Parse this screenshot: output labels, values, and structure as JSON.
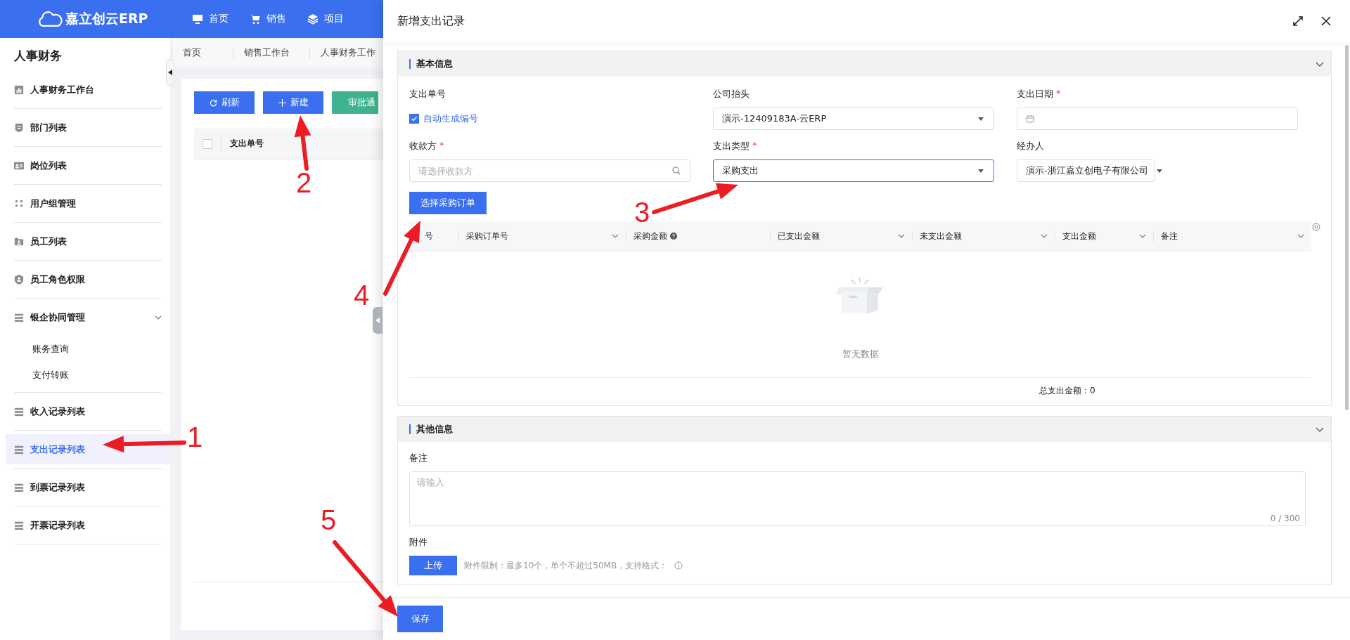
{
  "topbar": {
    "logo": "嘉立创云ERP",
    "nav": [
      {
        "label": "首页"
      },
      {
        "label": "销售"
      },
      {
        "label": "项目"
      }
    ]
  },
  "sidebar": {
    "title": "人事财务",
    "items": [
      {
        "label": "人事财务工作台",
        "selected": false
      },
      {
        "label": "部门列表",
        "selected": false
      },
      {
        "label": "岗位列表",
        "selected": false
      },
      {
        "label": "用户组管理",
        "selected": false
      },
      {
        "label": "员工列表",
        "selected": false
      },
      {
        "label": "员工角色权限",
        "selected": false
      },
      {
        "label": "银企协同管理",
        "selected": false,
        "expanded": true,
        "children": [
          {
            "label": "账务查询",
            "selected": false
          },
          {
            "label": "支付转账",
            "selected": false
          }
        ]
      },
      {
        "label": "收入记录列表",
        "selected": false
      },
      {
        "label": "支出记录列表",
        "selected": true
      },
      {
        "label": "到票记录列表",
        "selected": false
      },
      {
        "label": "开票记录列表",
        "selected": false
      }
    ]
  },
  "page_tabs": [
    "首页",
    "销售工作台",
    "人事财务工作"
  ],
  "toolbar": [
    {
      "label": "刷新",
      "kind": "refresh"
    },
    {
      "label": "新建",
      "kind": "add"
    },
    {
      "label": "审批通",
      "kind": "approve"
    }
  ],
  "list_table": {
    "select_all_checked": false,
    "columns": [
      "支出单号"
    ]
  },
  "drawer": {
    "title": "新增支出记录",
    "basic": {
      "title": "基本信息",
      "expanded": true,
      "fields": [
        {
          "label": "支出单号",
          "kind": "checkbox",
          "option": "自动生成编号",
          "checked": true
        },
        {
          "label": "公司抬头",
          "kind": "select",
          "value": "演示-12409183A-云ERP",
          "focused": false
        },
        {
          "label": "支出日期",
          "required_mark": "*",
          "kind": "date"
        },
        {
          "label": "收款方",
          "required_mark": "*",
          "kind": "search",
          "placeholder": "请选择收款方"
        },
        {
          "label": "支出类型",
          "required_mark": "*",
          "kind": "select",
          "value": "采购支出",
          "focused": true
        },
        {
          "label": "经办人",
          "kind": "compact",
          "value": "演示-浙江嘉立创电子有限公司",
          "focused": false
        }
      ],
      "action": "选择采购订单",
      "table": {
        "columns": [
          {
            "label": "号",
            "filter": false,
            "help": false
          },
          {
            "label": "采购订单号",
            "filter": true,
            "help": false
          },
          {
            "label": "采购金额",
            "filter": false,
            "help": true
          },
          {
            "label": "已支出金额",
            "filter": true,
            "help": false
          },
          {
            "label": "未支出金额",
            "filter": true,
            "help": false
          },
          {
            "label": "支出金额",
            "filter": true,
            "help": false
          },
          {
            "label": "备注",
            "filter": true,
            "help": false
          }
        ],
        "empty_text": "暂无数据",
        "total": "总支出金额：0"
      }
    },
    "other": {
      "title": "其他信息",
      "expanded": true,
      "remark": {
        "label": "备注",
        "placeholder": "请输入",
        "counter": "0 / 300"
      },
      "attachment": {
        "label": "附件",
        "button": "上传",
        "hint": "附件限制：最多10个，单个不超过50MB，支持格式："
      }
    },
    "save": "保存"
  },
  "annotations": [
    {
      "label": "1"
    },
    {
      "label": "2"
    },
    {
      "label": "3"
    },
    {
      "label": "4"
    },
    {
      "label": "5"
    }
  ]
}
